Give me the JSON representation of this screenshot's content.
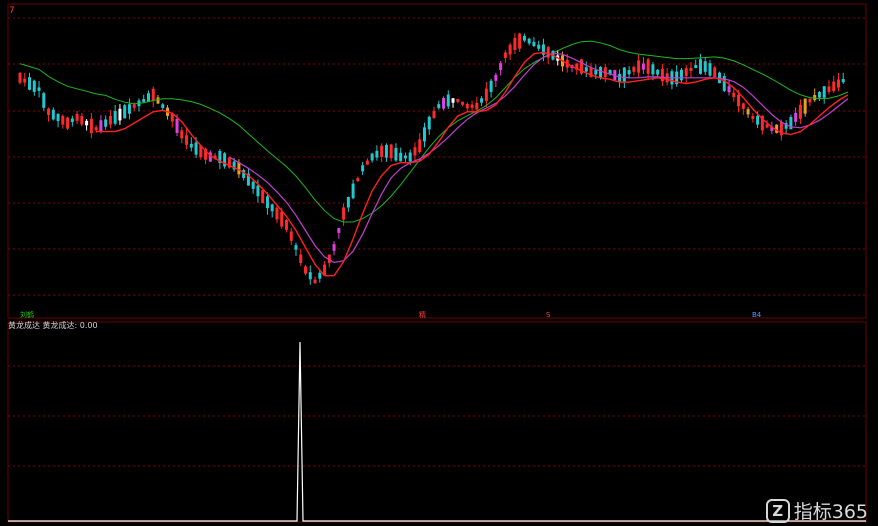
{
  "app": {
    "corner_label": "7"
  },
  "markers": [
    {
      "text": "刘鹤",
      "color": "#1bd51b"
    },
    {
      "text": "精",
      "color": "#ff4040"
    },
    {
      "text": "S",
      "color": "#ff4040"
    },
    {
      "text": "B4",
      "color": "#4a9cff"
    }
  ],
  "indicator": {
    "name": "黄龙成达",
    "series_label": "黄龙成达",
    "value": "0.00"
  },
  "watermark": {
    "logo_letter": "Z",
    "text": "指标365"
  },
  "colors": {
    "up": "#ff2b2b",
    "down": "#20c8d0",
    "grid": "#8b0000",
    "ma_short": "#ff2020",
    "ma_mid": "#c040d0",
    "ma_long": "#1db81d",
    "ma_white": "#ffffff",
    "highlight_pink": "#e040e0",
    "highlight_orange": "#e8a020",
    "signal": "#ffffff"
  },
  "chart_data": {
    "type": "candlestick",
    "price": {
      "close_trend": [
        100,
        99,
        98,
        94,
        93,
        92,
        93,
        92,
        91,
        92,
        93,
        94,
        95,
        96,
        97,
        95,
        93,
        90,
        88,
        87,
        86,
        86,
        85,
        84,
        82,
        80,
        78,
        76,
        74,
        70,
        66,
        64,
        66,
        70,
        76,
        80,
        84,
        86,
        87,
        87,
        86,
        86,
        88,
        92,
        95,
        96,
        96,
        95,
        95,
        97,
        100,
        104,
        106,
        107,
        106,
        105,
        104,
        103,
        102,
        102,
        101,
        101,
        101,
        100,
        101,
        102,
        102,
        101,
        100,
        100,
        101,
        102,
        102,
        101,
        99,
        97,
        95,
        93,
        92,
        91,
        91,
        92,
        94,
        96,
        97,
        98,
        99,
        100
      ],
      "ma_short": "red",
      "ma_mid": "purple",
      "ma_long": "green"
    },
    "indicator": {
      "name": "黄龙成达",
      "signal_index": 37,
      "values_note": "single spike then zero"
    }
  }
}
